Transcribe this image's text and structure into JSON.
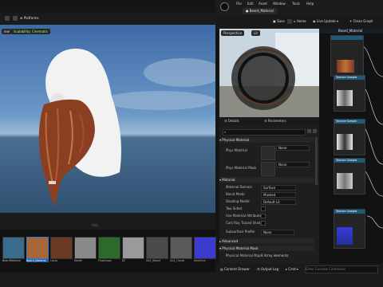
{
  "left": {
    "toolbar": {
      "platforms": "Platforms"
    },
    "viewport": {
      "view_label": "iew",
      "scalability_label": "Scalability: Cinematic"
    },
    "assets": [
      {
        "label": "BeardMaterial",
        "color": "#3b6b8c"
      },
      {
        "label": "Beard_Material",
        "color": "#a8653a"
      },
      {
        "label": "Locks",
        "color": "#6b3a22"
      },
      {
        "label": "Depth",
        "color": "#8a8a8a"
      },
      {
        "label": "Flowmaps",
        "color": "#2b6a2b"
      },
      {
        "label": "ID",
        "color": "#9a9a9a"
      },
      {
        "label": "Go1_Beard",
        "color": "#4a4a4a"
      },
      {
        "label": "Go1_Comb",
        "color": "#5a5a5a"
      },
      {
        "label": "Innerline",
        "color": "#3b3bd0"
      }
    ]
  },
  "right": {
    "menu": [
      "File",
      "Edit",
      "Asset",
      "Window",
      "Tools",
      "Help"
    ],
    "tab_title": "Beard_Material",
    "toolbar": {
      "save": "Save",
      "home": "Home",
      "live_update": "Live Update",
      "clean_graph": "Clean Graph"
    },
    "preview": {
      "mode": "Perspective",
      "lit": "Lit"
    },
    "panel_tabs": {
      "details": "Details",
      "parameters": "Parameters"
    },
    "details": {
      "physical_material_section": "Physical Material",
      "phys_material_label": "Phys Material",
      "phys_material_mask_label": "Phys Material Mask",
      "none1": "None",
      "none2": "None",
      "material_section": "Material",
      "rows": [
        {
          "label": "Material Domain",
          "value": "Surface"
        },
        {
          "label": "Blend Mode",
          "value": "Masked"
        },
        {
          "label": "Shading Model",
          "value": "Default Lit"
        },
        {
          "label": "Two Sided",
          "value": ""
        },
        {
          "label": "Use Material Attributes",
          "value": ""
        },
        {
          "label": "Cast Ray Traced Shad...",
          "value": ""
        },
        {
          "label": "Subsurface Profile",
          "value": "None"
        }
      ],
      "advanced_section": "Advanced",
      "mesh_section": "Physical Material Mask",
      "mesh_row_label": "Physical Material Map",
      "mesh_row_value": "8 Array elements"
    },
    "graph": {
      "title": "Beard_Material",
      "nodes": [
        "Texture Sample",
        "Texture Sample",
        "Texture Sample",
        "Texture Sample"
      ]
    },
    "bottom": {
      "content_drawer": "Content Drawer",
      "output_log": "Output Log",
      "cmd": "Cmd",
      "console": "Enter Console Command"
    }
  }
}
